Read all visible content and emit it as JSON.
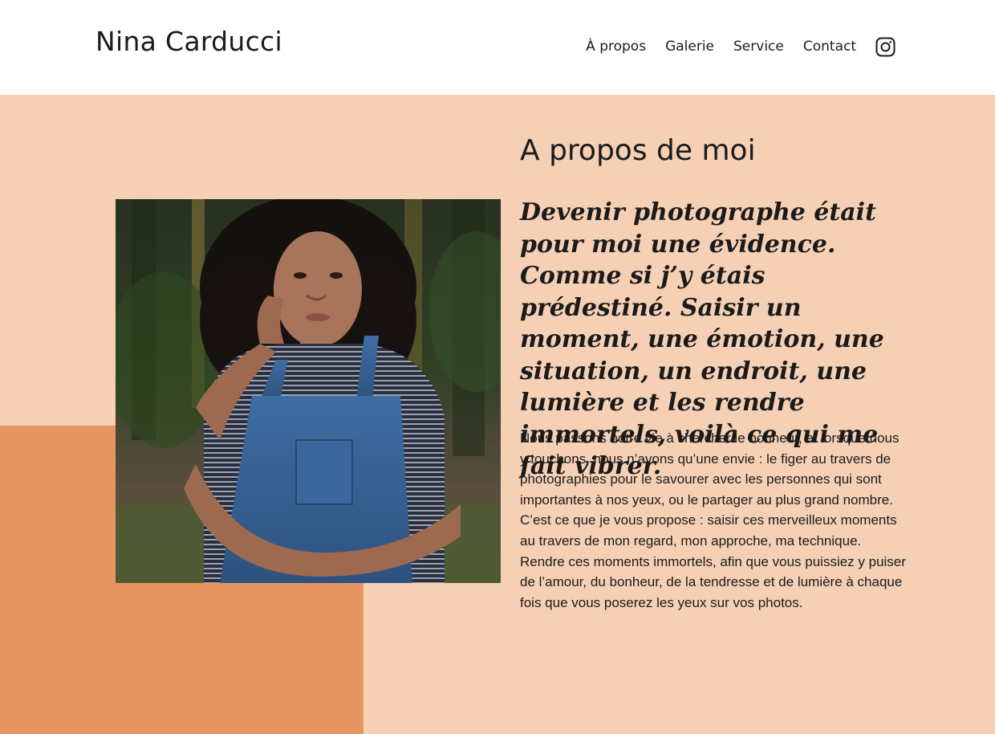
{
  "header": {
    "site_title": "Nina Carducci",
    "nav": [
      "À propos",
      "Galerie",
      "Service",
      "Contact"
    ],
    "social_icon": "instagram-icon"
  },
  "about": {
    "title": "A propos de moi",
    "quote": "Devenir photographe était pour moi une évidence. Comme si j’y étais prédestiné. Saisir un moment, une émotion, une situation, un endroit, une lumière et les rendre immortels, voilà ce qui me fait vibrer.",
    "body": "Nous passons notre vie à chercher le bonheur, et lorsque nous y touchons, nous n’avons qu’une envie : le figer au travers de photographies pour le savourer avec les personnes qui sont importantes à nos yeux, ou le partager au plus grand nombre. C’est ce que je vous propose : saisir ces merveilleux moments au travers de mon regard, mon approche, ma technique. Rendre ces moments immortels, afin que vous puissiez y puiser de l’amour, du bonheur, de la tendresse et de lumière à chaque fois que vous poserez les yeux sur vos photos."
  },
  "colors": {
    "section_bg": "#f5d0b5",
    "accent_block": "#e69560",
    "text": "#1b1b1b",
    "header_bg": "#ffffff"
  }
}
